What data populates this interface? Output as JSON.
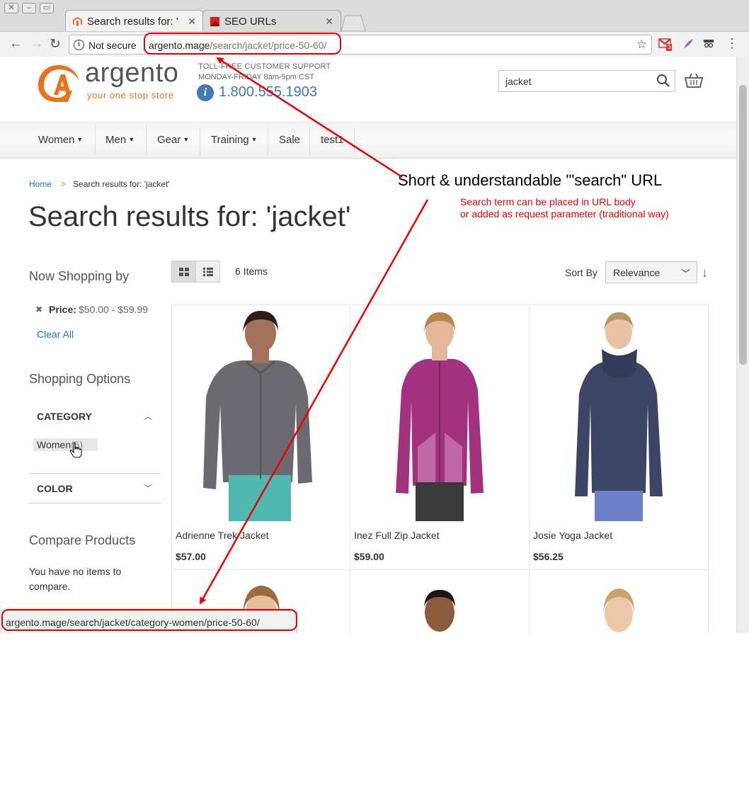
{
  "browser": {
    "tabs": [
      {
        "title": "Search results for: '",
        "active": true
      },
      {
        "title": "SEO URLs",
        "active": false
      }
    ],
    "security_label": "Not secure",
    "url_host": "argento.mage",
    "url_path": "/search/jacket/price-50-60/",
    "extension_badge": "3",
    "status_url": "argento.mage/search/jacket/category-women/price-50-60/"
  },
  "header": {
    "logo_text": "argento",
    "logo_tagline": "your one stop store",
    "support_line1": "TOLL-FREE CUSTOMER SUPPORT",
    "support_line2": "MONDAY-FRIDAY 8am-5pm CST",
    "support_phone": "1.800.555.1903",
    "search_value": "jacket"
  },
  "nav": {
    "items": [
      "Women",
      "Men",
      "Gear",
      "Training",
      "Sale",
      "test1"
    ]
  },
  "breadcrumb": {
    "home": "Home",
    "current": "Search results for: 'jacket'"
  },
  "page_title": "Search results for: 'jacket'",
  "annotation": {
    "title": "Short & understandable '\"search\" URL",
    "line1": "Search term can be placed in URL body",
    "line2": "or added as request parameter (traditional way)"
  },
  "sidebar": {
    "now_shopping_title": "Now Shopping by",
    "filter_label": "Price:",
    "filter_value": "$50.00 - $59.99",
    "clear_all": "Clear All",
    "shopping_options_title": "Shopping Options",
    "category_heading": "CATEGORY",
    "category_item": "Women",
    "category_count": "(5)",
    "color_heading": "COLOR",
    "compare_title": "Compare Products",
    "compare_empty": "You have no items to compare."
  },
  "toolbar": {
    "items_count": "6 Items",
    "sort_label": "Sort By",
    "sort_value": "Relevance"
  },
  "products": [
    {
      "name": "Adrienne Trek Jacket",
      "price": "$57.00",
      "color": "#6a6a70"
    },
    {
      "name": "Inez Full Zip Jacket",
      "price": "$59.00",
      "color": "#a2327e"
    },
    {
      "name": "Josie Yoga Jacket",
      "price": "$56.25",
      "color": "#3c4566"
    }
  ],
  "colors": {
    "accent_blue": "#1979c3",
    "logo_orange": "#e9731c",
    "annotation_red": "#e00000"
  }
}
